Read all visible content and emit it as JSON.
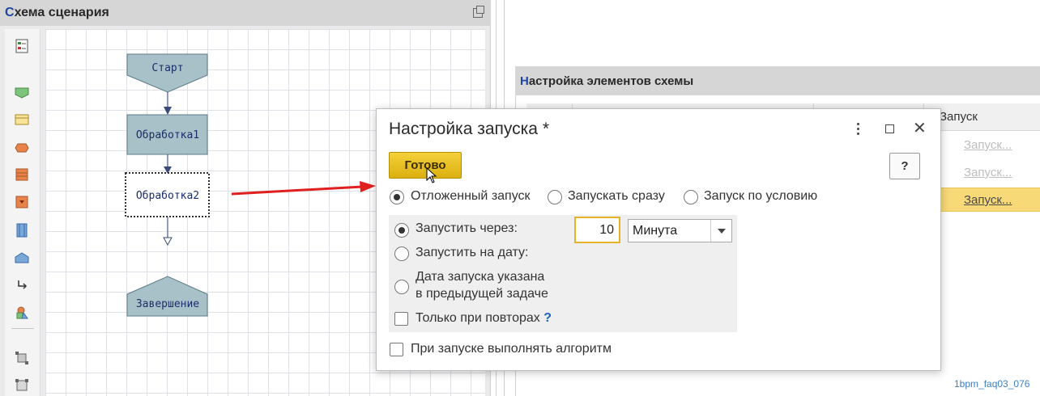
{
  "left_panel": {
    "title_first_letter": "С",
    "title_rest": "хема сценария"
  },
  "diagram": {
    "start_label": "Старт",
    "step1_label": "Обработка1",
    "step2_label": "Обработка2",
    "end_label": "Завершение"
  },
  "right_panel": {
    "title_first_letter": "Н",
    "title_rest": "астройка элементов схемы",
    "column_header_launch": "Запуск",
    "rows": [
      {
        "launch": "Запуск..."
      },
      {
        "launch": "Запуск..."
      },
      {
        "launch": "Запуск..."
      }
    ]
  },
  "dialog": {
    "title": "Настройка запуска *",
    "done_label": "Готово",
    "help_label": "?",
    "mode_options": {
      "deferred": "Отложенный запуск",
      "immediate": "Запускать сразу",
      "conditional": "Запуск по условию"
    },
    "selected_mode": "deferred",
    "schedule_options": {
      "after": "Запустить через:",
      "on_date": "Запустить на дату:",
      "prev_task_line1": "Дата запуска указана",
      "prev_task_line2": "в предыдущей задаче"
    },
    "selected_schedule": "after",
    "delay_value": "10",
    "delay_unit": "Минута",
    "only_on_repeat_label": "Только при повторах",
    "only_on_repeat_help": "?",
    "run_algorithm_label": "При запуске выполнять алгоритм"
  },
  "watermark": "1bpm_faq03_076",
  "colors": {
    "accent_yellow": "#e6b227",
    "title_accent": "#1e46a6",
    "arrow_red": "#e02020"
  }
}
